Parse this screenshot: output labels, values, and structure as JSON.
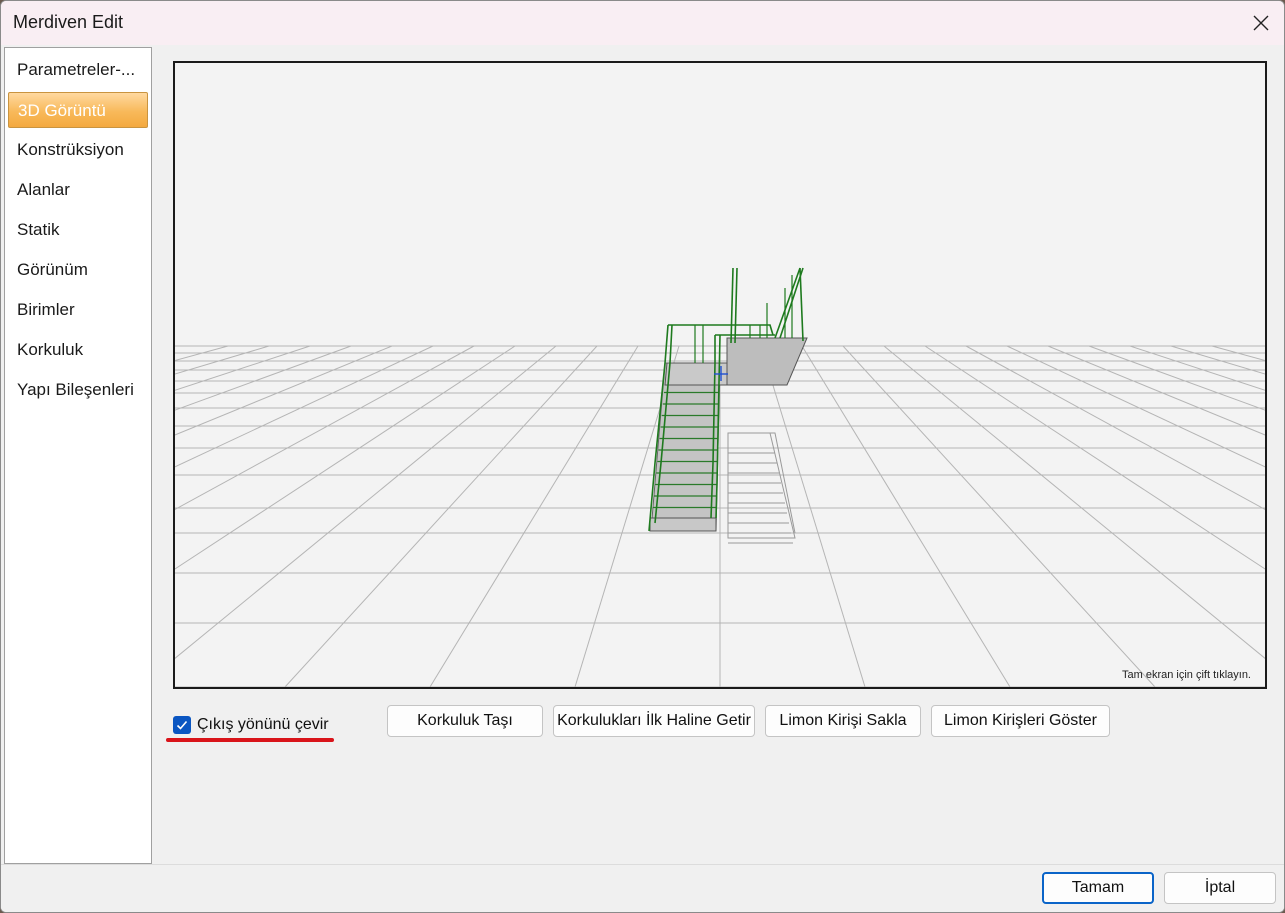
{
  "window": {
    "title": "Merdiven Edit"
  },
  "nav": {
    "items": [
      {
        "label": "Parametreler-..."
      },
      {
        "label": "3D Görüntü"
      },
      {
        "label": "Konstrüksiyon"
      },
      {
        "label": "Alanlar"
      },
      {
        "label": "Statik"
      },
      {
        "label": "Görünüm"
      },
      {
        "label": "Birimler"
      },
      {
        "label": "Korkuluk"
      },
      {
        "label": "Yapı Bileşenleri"
      }
    ],
    "selected": "3D Görüntü"
  },
  "viewport": {
    "hint": "Tam ekran için çift tıklayın."
  },
  "options": {
    "flip_exit_label": "Çıkış yönünü çevir",
    "flip_exit_checked": true
  },
  "actions": {
    "move_railing": "Korkuluk Taşı",
    "reset_railings": "Korkulukları İlk Haline Getir",
    "hide_stringer": "Limon Kirişi Sakla",
    "show_stringers": "Limon Kirişleri Göster"
  },
  "footer": {
    "ok": "Tamam",
    "cancel": "İptal"
  },
  "colors": {
    "accent_blue": "#0a64c8",
    "railing_green": "#1e7a1e",
    "selected_orange": "#f4a93f",
    "annotation_red": "#d9141a"
  }
}
